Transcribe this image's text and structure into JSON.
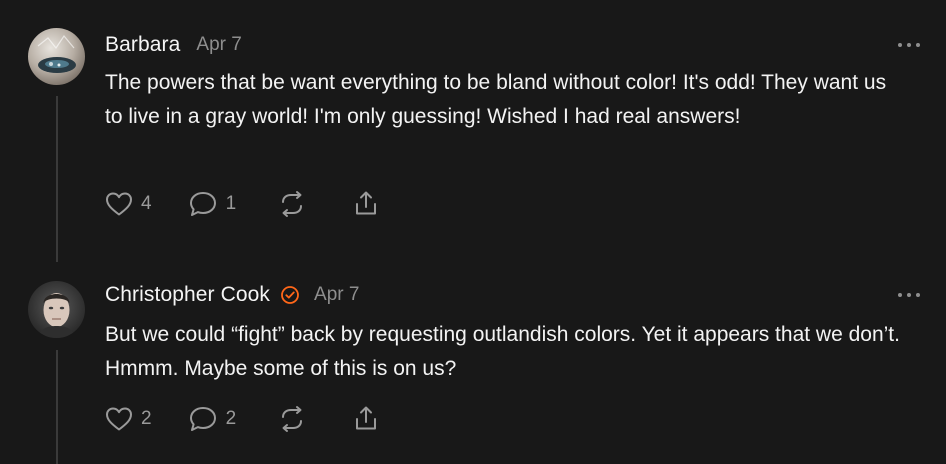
{
  "comments": [
    {
      "author": "Barbara",
      "verified": false,
      "date": "Apr 7",
      "text": "The powers that be want everything to be bland without color! It's odd! They want us to live in a gray world! I'm only guessing! Wished I had real answers!",
      "likes": "4",
      "replies": "1",
      "avatar_icon": "photo-avatar"
    },
    {
      "author": "Christopher Cook",
      "verified": true,
      "date": "Apr 7",
      "text": "But we could “fight” back by requesting outlandish colors. Yet it appears that we don’t. Hmmm. Maybe some of this is on us?",
      "likes": "2",
      "replies": "2",
      "avatar_icon": "photo-avatar"
    }
  ],
  "icons": {
    "like": "heart-icon",
    "reply": "comment-icon",
    "restack": "restack-icon",
    "share": "share-icon",
    "more": "more-icon",
    "verified": "verified-check-icon"
  },
  "colors": {
    "background": "#181818",
    "text": "#f3f3f3",
    "muted": "#8e8e8e",
    "verified_accent": "#ff6719"
  }
}
